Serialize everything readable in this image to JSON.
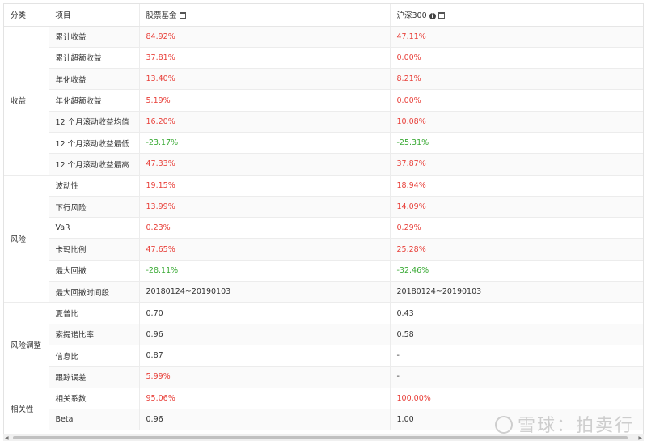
{
  "header": {
    "category": "分类",
    "item": "项目",
    "fund": "股票基金",
    "benchmark": "沪深300"
  },
  "rows": [
    {
      "item": "累计收益",
      "fund": "84.92%",
      "bench": "47.11%"
    },
    {
      "item": "累计超额收益",
      "fund": "37.81%",
      "bench": "0.00%"
    },
    {
      "item": "年化收益",
      "fund": "13.40%",
      "bench": "8.21%"
    },
    {
      "item": "年化超额收益",
      "fund": "5.19%",
      "bench": "0.00%"
    },
    {
      "item": "12 个月滚动收益均值",
      "fund": "16.20%",
      "bench": "10.08%"
    },
    {
      "item": "12 个月滚动收益最低",
      "fund": "-23.17%",
      "bench": "-25.31%"
    },
    {
      "item": "12 个月滚动收益最高",
      "fund": "47.33%",
      "bench": "37.87%"
    },
    {
      "item": "波动性",
      "fund": "19.15%",
      "bench": "18.94%"
    },
    {
      "item": "下行风险",
      "fund": "13.99%",
      "bench": "14.09%"
    },
    {
      "item": "VaR",
      "fund": "0.23%",
      "bench": "0.29%"
    },
    {
      "item": "卡玛比例",
      "fund": "47.65%",
      "bench": "25.28%"
    },
    {
      "item": "最大回撤",
      "fund": "-28.11%",
      "bench": "-32.46%"
    },
    {
      "item": "最大回撤时间段",
      "fund": "20180124~20190103",
      "bench": "20180124~20190103"
    },
    {
      "item": "夏普比",
      "fund": "0.70",
      "bench": "0.43"
    },
    {
      "item": "索提诺比率",
      "fund": "0.96",
      "bench": "0.58"
    },
    {
      "item": "信息比",
      "fund": "0.87",
      "bench": "-"
    },
    {
      "item": "跟踪误差",
      "fund": "5.99%",
      "bench": "-"
    },
    {
      "item": "相关系数",
      "fund": "95.06%",
      "bench": "100.00%"
    },
    {
      "item": "Beta",
      "fund": "0.96",
      "bench": "1.00"
    }
  ],
  "categories": [
    {
      "label": "收益",
      "span": 7
    },
    {
      "label": "风险",
      "span": 6
    },
    {
      "label": "风险调整",
      "span": 4
    },
    {
      "label": "相关性",
      "span": 2
    }
  ],
  "colors": {
    "positive": "#e8403a",
    "negative": "#3aaa35"
  },
  "icons": {
    "fund_header": "calendar-icon",
    "benchmark_header": [
      "info-icon",
      "calendar-icon"
    ]
  },
  "watermark": "雪球：拍卖行"
}
